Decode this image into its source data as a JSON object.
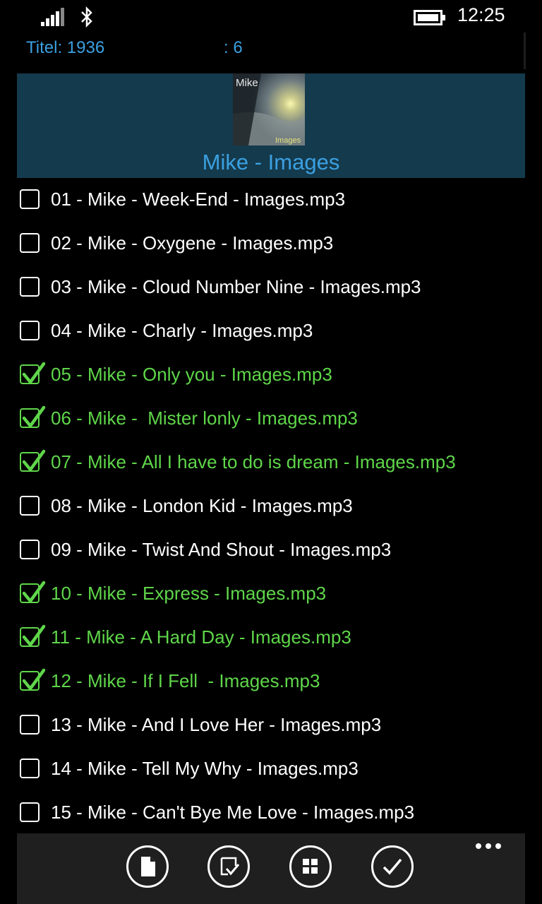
{
  "status_bar": {
    "time": "12:25"
  },
  "info": {
    "title": "Titel: 1936",
    "count": ": 6"
  },
  "album": {
    "art_top_text": "Mike",
    "art_bottom_text": "Images",
    "title": "Mike - Images"
  },
  "tracks": [
    {
      "label": "01 - Mike - Week-End - Images.mp3",
      "checked": false
    },
    {
      "label": "02 - Mike - Oxygene - Images.mp3",
      "checked": false
    },
    {
      "label": "03 - Mike - Cloud Number Nine - Images.mp3",
      "checked": false
    },
    {
      "label": "04 - Mike - Charly - Images.mp3",
      "checked": false
    },
    {
      "label": "05 - Mike - Only you - Images.mp3",
      "checked": true
    },
    {
      "label": "06 - Mike -  Mister lonly - Images.mp3",
      "checked": true
    },
    {
      "label": "07 - Mike - All I have to do is dream - Images.mp3",
      "checked": true
    },
    {
      "label": "08 - Mike - London Kid - Images.mp3",
      "checked": false
    },
    {
      "label": "09 - Mike - Twist And Shout - Images.mp3",
      "checked": false
    },
    {
      "label": "10 - Mike - Express - Images.mp3",
      "checked": true
    },
    {
      "label": "11 - Mike - A Hard Day - Images.mp3",
      "checked": true
    },
    {
      "label": "12 - Mike - If I Fell  - Images.mp3",
      "checked": true
    },
    {
      "label": "13 - Mike - And I Love Her - Images.mp3",
      "checked": false
    },
    {
      "label": "14 - Mike - Tell My Why - Images.mp3",
      "checked": false
    },
    {
      "label": "15 - Mike - Can't Bye Me Love - Images.mp3",
      "checked": false
    }
  ],
  "app_bar": {
    "buttons": [
      {
        "icon": "document-icon"
      },
      {
        "icon": "select-checklist-icon"
      },
      {
        "icon": "grid-icon"
      },
      {
        "icon": "check-icon"
      }
    ]
  },
  "colors": {
    "accent": "#3ba0e0",
    "selected": "#5fd64a",
    "header_bg": "#143a4d",
    "app_bar_bg": "#1f1f1f"
  }
}
